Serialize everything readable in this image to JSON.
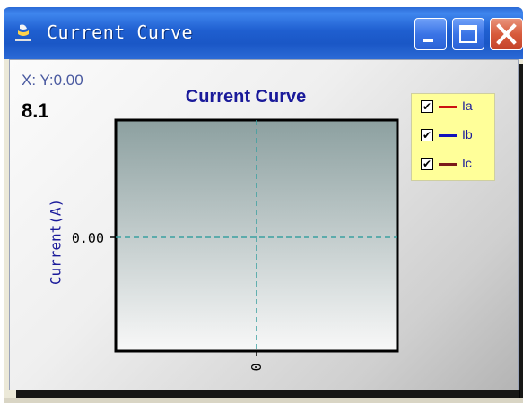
{
  "window": {
    "title": "Current Curve",
    "icon": "app-icon",
    "buttons": {
      "minimize": "minimize-icon",
      "maximize": "maximize-icon",
      "close": "close-icon"
    }
  },
  "readout": {
    "coord": "X: Y:0.00",
    "value": "8.1"
  },
  "legend": [
    {
      "label": "Ia",
      "checked": true,
      "check_glyph": "✔",
      "color": "#cc1111"
    },
    {
      "label": "Ib",
      "checked": true,
      "check_glyph": "✔",
      "color": "#1111bb"
    },
    {
      "label": "Ic",
      "checked": true,
      "check_glyph": "✔",
      "color": "#7a1a1a"
    }
  ],
  "chart_data": {
    "type": "line",
    "title": "Current Curve",
    "xlabel": "",
    "ylabel": "Current(A)",
    "x_ticks": [
      "0"
    ],
    "y_ticks": [
      "0.00"
    ],
    "series": [
      {
        "name": "Ia",
        "values": []
      },
      {
        "name": "Ib",
        "values": []
      },
      {
        "name": "Ic",
        "values": []
      }
    ],
    "grid": "dashed crosshair at 0",
    "legend_position": "top-right"
  },
  "colors": {
    "plot_gradient_top": "#8ca0a0",
    "plot_gradient_bottom": "#f8f8f8",
    "crosshair": "#3aa0a0",
    "title_text": "#1a1a9a"
  }
}
